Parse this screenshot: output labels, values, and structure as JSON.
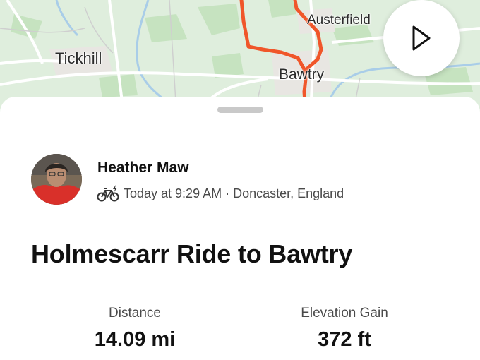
{
  "map": {
    "labels": {
      "tickhill": "Tickhill",
      "bawtry": "Bawtry",
      "austerfield": "Austerfield"
    },
    "route_color": "#f0562a"
  },
  "controls": {
    "play_icon": "play-icon"
  },
  "athlete": {
    "name": "Heather Maw",
    "activity_icon": "e-bike-icon",
    "meta": "Today at 9:29 AM · Doncaster, England"
  },
  "activity": {
    "title": "Holmescarr Ride to Bawtry"
  },
  "stats": [
    {
      "label": "Distance",
      "value": "14.09 mi"
    },
    {
      "label": "Elevation Gain",
      "value": "372 ft"
    }
  ]
}
